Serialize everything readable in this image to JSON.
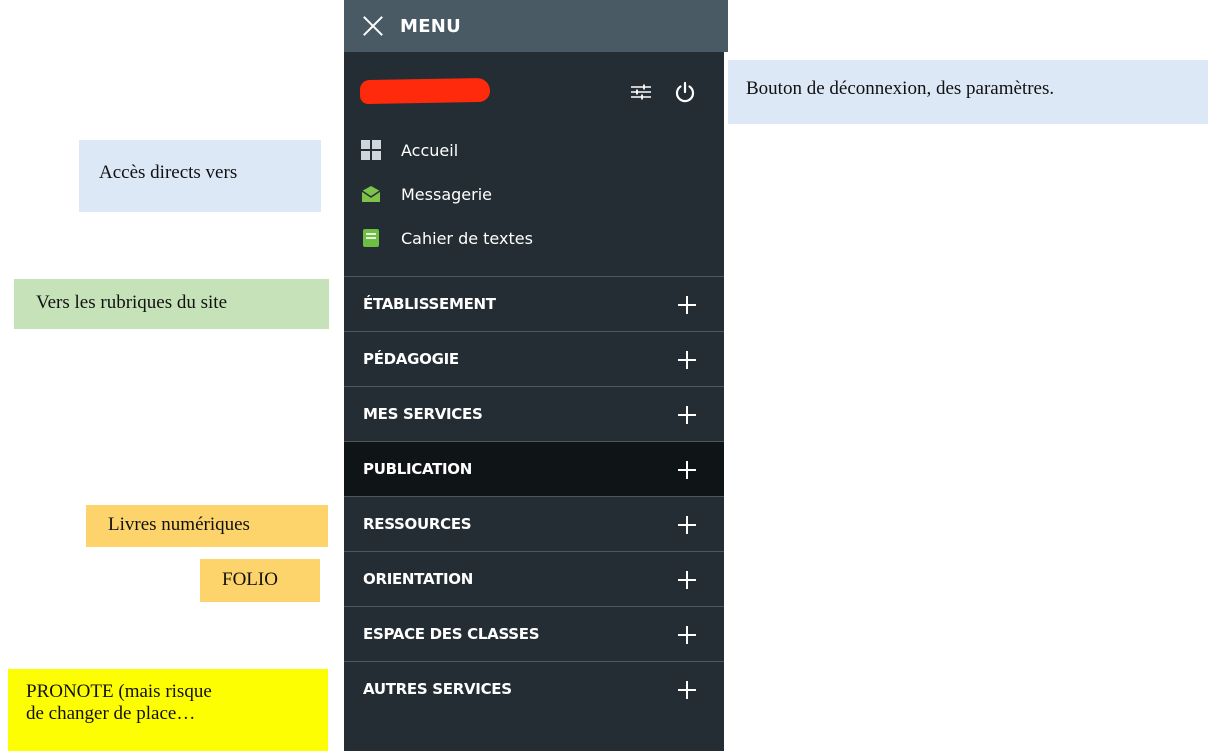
{
  "menu": {
    "header_label": "MENU",
    "icons": {
      "close": "close-icon",
      "settings": "sliders-icon",
      "power": "power-icon"
    },
    "quick_links": [
      {
        "label": "Accueil",
        "icon": "grid-icon",
        "color": "#cfd6dc"
      },
      {
        "label": "Messagerie",
        "icon": "envelope-icon",
        "color": "#7fc24a"
      },
      {
        "label": "Cahier de textes",
        "icon": "notebook-icon",
        "color": "#6fbe44"
      }
    ],
    "sections": [
      {
        "label": "ÉTABLISSEMENT",
        "active": false
      },
      {
        "label": "PÉDAGOGIE",
        "active": false
      },
      {
        "label": "MES SERVICES",
        "active": false
      },
      {
        "label": "PUBLICATION",
        "active": true
      },
      {
        "label": "RESSOURCES",
        "active": false
      },
      {
        "label": "ORIENTATION",
        "active": false
      },
      {
        "label": "ESPACE DES CLASSES",
        "active": false
      },
      {
        "label": "AUTRES SERVICES",
        "active": false
      }
    ]
  },
  "annotations": {
    "params": "Bouton de déconnexion, des paramètres.",
    "acces": "Accès directs vers",
    "rubriques": "Vers les rubriques du site",
    "livres": "Livres numériques",
    "folio": "FOLIO",
    "pronote_line1": "PRONOTE (mais risque",
    "pronote_line2": "de changer de place…"
  },
  "colors": {
    "panel_bg": "#232d33",
    "header_bg": "#4a5a64",
    "active_section_bg": "#0f1417",
    "redaction": "#ff2a0c",
    "note_blue": "#dce8f6",
    "note_green": "#c6e2b8",
    "note_orange": "#fdd36c",
    "note_yellow": "#fefe02"
  }
}
